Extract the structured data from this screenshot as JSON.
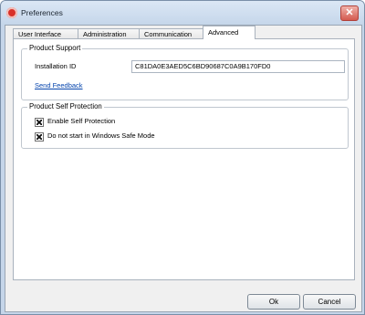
{
  "window": {
    "title": "Preferences",
    "close_symbol": "✕"
  },
  "tabs": [
    {
      "label": "User Interface"
    },
    {
      "label": "Administration"
    },
    {
      "label": "Communication"
    },
    {
      "label": "Advanced",
      "active": true
    }
  ],
  "product_support": {
    "title": "Product Support",
    "installation_id_label": "Installation ID",
    "installation_id_value": "C81DA0E3AED5C6BD90687C0A9B170FD0",
    "send_feedback_link": "Send Feedback"
  },
  "self_protection": {
    "title": "Product Self Protection",
    "options": [
      {
        "label": "Enable Self Protection",
        "checked": true
      },
      {
        "label": "Do not start in Windows Safe Mode",
        "checked": true
      }
    ]
  },
  "buttons": {
    "ok": "Ok",
    "cancel": "Cancel"
  }
}
